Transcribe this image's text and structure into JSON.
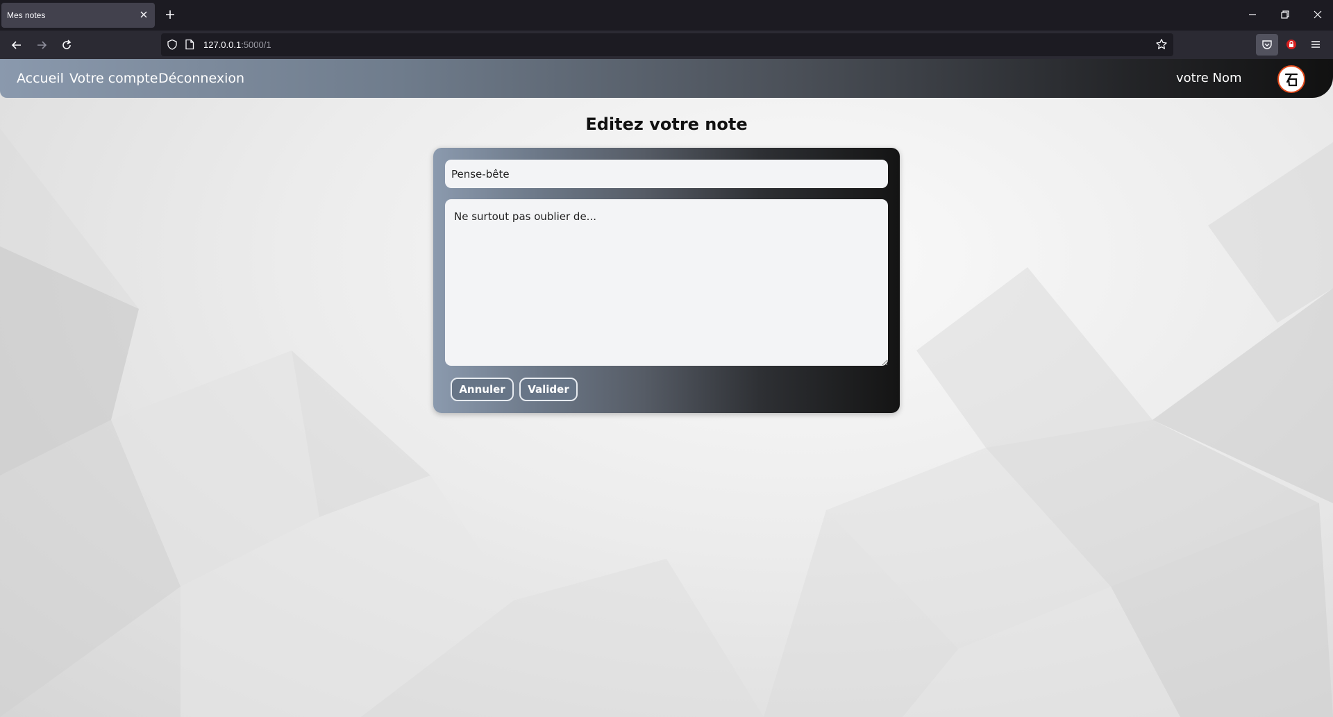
{
  "browser": {
    "tab_title": "Mes notes",
    "url_host": "127.0.0.1",
    "url_rest": ":5000/1"
  },
  "site": {
    "nav": {
      "home": "Accueil",
      "account": "Votre compte",
      "logout": "Déconnexion",
      "user_name": "votre Nom"
    },
    "page_title": "Editez votre note",
    "form": {
      "title_value": "Pense-bête",
      "body_value": "Ne surtout pas oublier de...",
      "cancel_label": "Annuler",
      "submit_label": "Valider"
    }
  },
  "icons": {
    "tab_close": "close-icon",
    "new_tab": "plus-icon",
    "back": "arrow-left-icon",
    "forward": "arrow-right-icon",
    "reload": "reload-icon",
    "tracking": "shield-icon",
    "page": "page-icon",
    "bookmark": "star-icon",
    "pocket": "pocket-icon",
    "extension": "extension-icon",
    "menu": "hamburger-menu-icon",
    "avatar": "logo-avatar-icon"
  },
  "colors": {
    "accent_logo": "#e24a1b",
    "nav_gradient_start": "#8a99ad",
    "nav_gradient_end": "#111111",
    "button_fill": "#677587"
  }
}
